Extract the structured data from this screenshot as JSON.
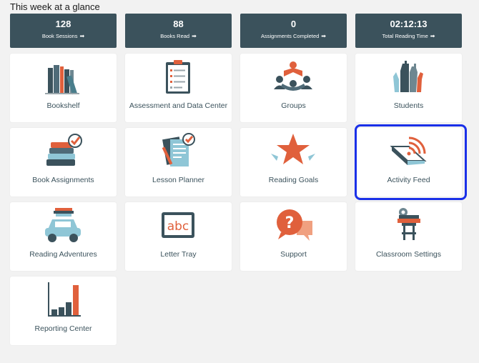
{
  "header": {
    "title": "This week at a glance"
  },
  "stats": [
    {
      "value": "128",
      "label": "Book Sessions"
    },
    {
      "value": "88",
      "label": "Books Read"
    },
    {
      "value": "0",
      "label": "Assignments Completed"
    },
    {
      "value": "02:12:13",
      "label": "Total Reading Time"
    }
  ],
  "tiles": [
    {
      "label": "Bookshelf",
      "icon": "bookshelf-icon"
    },
    {
      "label": "Assessment and Data Center",
      "icon": "clipboard-icon"
    },
    {
      "label": "Groups",
      "icon": "groups-icon"
    },
    {
      "label": "Students",
      "icon": "raised-hands-icon"
    },
    {
      "label": "Book Assignments",
      "icon": "book-stack-check-icon"
    },
    {
      "label": "Lesson Planner",
      "icon": "lesson-planner-icon"
    },
    {
      "label": "Reading Goals",
      "icon": "star-icon"
    },
    {
      "label": "Activity Feed",
      "icon": "book-feed-icon"
    },
    {
      "label": "Reading Adventures",
      "icon": "car-books-icon"
    },
    {
      "label": "Letter Tray",
      "icon": "abc-board-icon"
    },
    {
      "label": "Support",
      "icon": "question-bubble-icon"
    },
    {
      "label": "Classroom Settings",
      "icon": "desk-gear-icon"
    },
    {
      "label": "Reporting Center",
      "icon": "bar-chart-icon"
    }
  ],
  "colors": {
    "stat_bg": "#3b525c",
    "accent": "#e0603c",
    "selection": "#1a30e8",
    "tile_text": "#3b525c"
  }
}
